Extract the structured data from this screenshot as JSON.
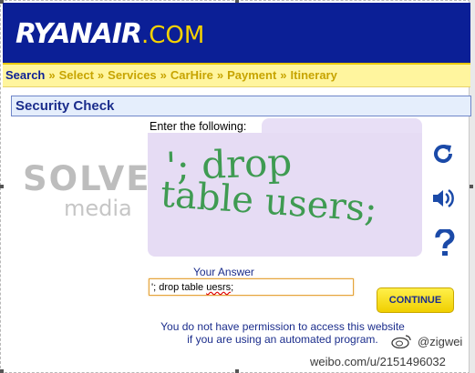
{
  "header": {
    "logo_main": "RYANAIR",
    "logo_suffix": ".COM"
  },
  "nav": {
    "steps": [
      "Search",
      "Select",
      "Services",
      "CarHire",
      "Payment",
      "Itinerary"
    ],
    "separator": "»",
    "active": "Search"
  },
  "section": {
    "title": "Security Check"
  },
  "branding": {
    "line1": "SOLVE",
    "line2": "media"
  },
  "captcha": {
    "prompt": "Enter the following:",
    "line1": "'; drop",
    "line2": "table users;"
  },
  "icons": [
    "refresh-icon",
    "audio-icon",
    "help-icon"
  ],
  "answer": {
    "label": "Your Answer",
    "value_prefix": "'; drop table ",
    "value_misspelled": "uesrs",
    "value_suffix": ";"
  },
  "continue_label": "CONTINUE",
  "warning": {
    "line1": "You do not have permission to access this website",
    "line2": "if you are using an automated program."
  },
  "watermark": {
    "handle": "@zigwei",
    "url": "weibo.com/u/2151496032"
  },
  "colors": {
    "brand_blue": "#0b1f96",
    "brand_yellow": "#f5d200",
    "captcha_green": "#3f9b52"
  }
}
